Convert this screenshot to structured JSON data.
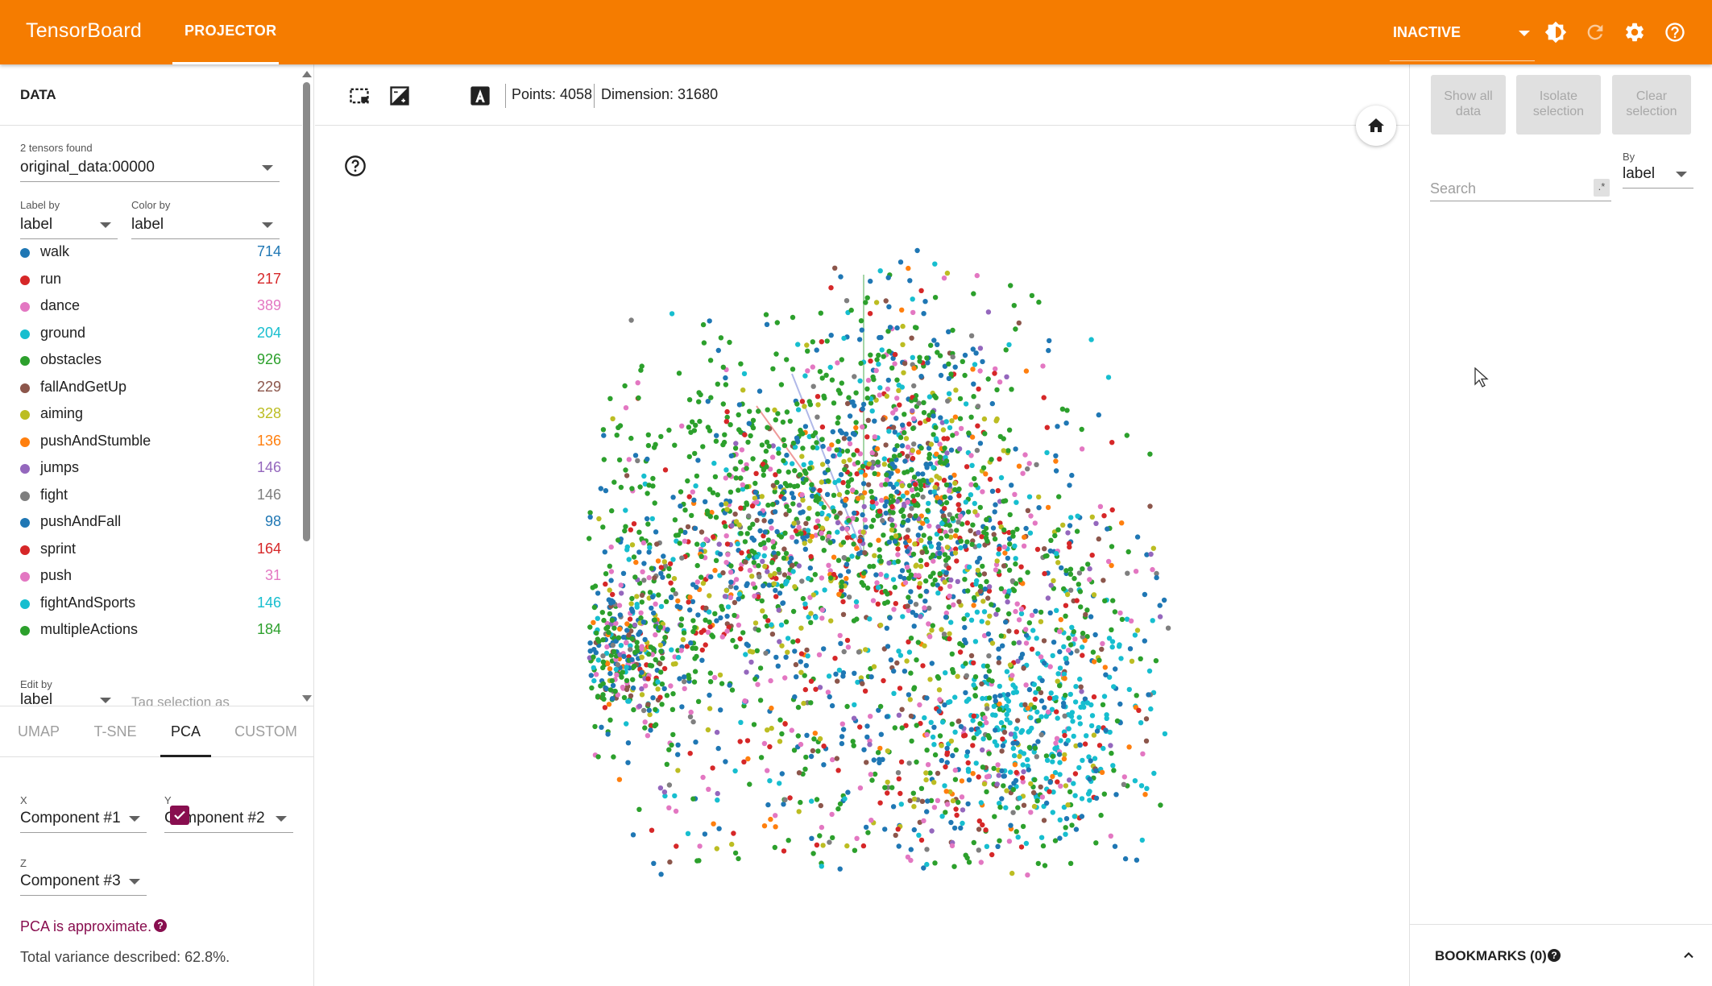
{
  "header": {
    "brand": "TensorBoard",
    "nav_tab": "PROJECTOR",
    "run_selector": "INACTIVE",
    "icons": [
      "theme-icon",
      "refresh-icon",
      "settings-icon",
      "help-icon"
    ]
  },
  "left_panel": {
    "title": "DATA",
    "tensors_found": "2 tensors found",
    "tensor_select": "original_data:00000",
    "label_by_label": "Label by",
    "label_by_value": "label",
    "color_by_label": "Color by",
    "color_by_value": "label",
    "legend": [
      {
        "name": "walk",
        "count": "714",
        "color": "#1f77b4"
      },
      {
        "name": "run",
        "count": "217",
        "color": "#d62728"
      },
      {
        "name": "dance",
        "count": "389",
        "color": "#e377c2"
      },
      {
        "name": "ground",
        "count": "204",
        "color": "#17becf"
      },
      {
        "name": "obstacles",
        "count": "926",
        "color": "#2ca02c"
      },
      {
        "name": "fallAndGetUp",
        "count": "229",
        "color": "#8c564b"
      },
      {
        "name": "aiming",
        "count": "328",
        "color": "#bcbd22"
      },
      {
        "name": "pushAndStumble",
        "count": "136",
        "color": "#ff7f0e"
      },
      {
        "name": "jumps",
        "count": "146",
        "color": "#9467bd"
      },
      {
        "name": "fight",
        "count": "146",
        "color": "#7f7f7f"
      },
      {
        "name": "pushAndFall",
        "count": "98",
        "color": "#1f77b4"
      },
      {
        "name": "sprint",
        "count": "164",
        "color": "#d62728"
      },
      {
        "name": "push",
        "count": "31",
        "color": "#e377c2"
      },
      {
        "name": "fightAndSports",
        "count": "146",
        "color": "#17becf"
      },
      {
        "name": "multipleActions",
        "count": "184",
        "color": "#2ca02c"
      }
    ],
    "edit_by_label": "Edit by",
    "edit_by_value": "label",
    "tag_selection_placeholder": "Tag selection as",
    "projection_tabs": [
      "UMAP",
      "T-SNE",
      "PCA",
      "CUSTOM"
    ],
    "active_tab": "PCA",
    "x_label": "X",
    "x_value": "Component #1",
    "y_label": "Y",
    "y_value": "Component #2",
    "z_label": "Z",
    "z_value": "Component #3",
    "z_enabled": true,
    "pca_note": "PCA is approximate.",
    "variance": "Total variance described: 62.8%."
  },
  "toolbar": {
    "points": "Points: 4058",
    "dimension": "Dimension: 31680"
  },
  "right_panel": {
    "show_all": "Show all data",
    "isolate": "Isolate selection",
    "clear": "Clear selection",
    "search_placeholder": "Search",
    "regex": ".*",
    "by_label": "By",
    "by_value": "label",
    "bookmarks": "BOOKMARKS (0)"
  },
  "colors": {
    "header": "#f57c00",
    "accent": "#880e4f"
  },
  "scatter_settings": {
    "seed": 7,
    "total_points": 4058
  }
}
